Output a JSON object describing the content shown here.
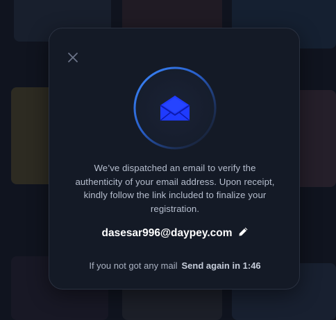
{
  "modal": {
    "message": "We’ve dispatched an email to verify the authenticity of your email address. Upon receipt, kindly follow the link included to finalize your registration.",
    "email": "dasesar996@daypey.com",
    "resend_hint": "If you not got any mail",
    "resend_action": "Send again in 1:46"
  },
  "icons": {
    "close": "close-icon",
    "envelope": "envelope-open-icon",
    "edit": "pencil-icon"
  },
  "colors": {
    "accent": "#1f3bff",
    "ring": "#2f7cff",
    "modal_bg": "#141a26"
  }
}
